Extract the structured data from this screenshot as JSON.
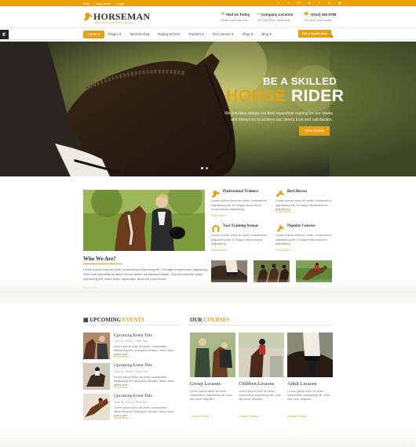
{
  "topbar": {
    "links": [
      "FAQ",
      "Help Desk",
      "Login"
    ],
    "social_icons": [
      "facebook-icon",
      "twitter-icon",
      "google-plus-icon",
      "instagram-icon",
      "pinterest-icon",
      "linkedin-icon",
      "rss-icon"
    ],
    "social_glyphs": [
      "f",
      "t",
      "G+",
      "◎",
      "P",
      "in",
      "◉"
    ]
  },
  "brand": {
    "name": "HORSEMAN",
    "tagline": "BEST EQUESTRIAN CENTER"
  },
  "header_info": {
    "mail": {
      "label": "Mail Us Today",
      "value": "info@yourdomain.com"
    },
    "location": {
      "label": "Company Location",
      "value": "121 King Street, Melbourne"
    },
    "phone": {
      "label": "+(012) 345 6789",
      "value": "Call us for more details"
    }
  },
  "nav": {
    "items": [
      "Home",
      "Pages",
      "Membership",
      "Riding School",
      "Trainers",
      "Our Horses",
      "Shop",
      "Blog"
    ],
    "dropdown": [
      true,
      true,
      false,
      false,
      true,
      true,
      true,
      true
    ],
    "cta": "Get A Quote Now"
  },
  "hero": {
    "line1": "BE A SKILLED",
    "line2_highlight": "HORSE",
    "line2_rest": "RIDER",
    "text": "We provides always our best equestrian training for our clients and always try to achieve our client's trust and satisfaction.",
    "button": "View Details",
    "slide_count": 2,
    "active_slide": 1
  },
  "features": [
    {
      "title": "Professional Trainers",
      "text": "Lorem ipsum dolor sit amet, consectetur adipisicing elit. El magni temporibus tempoesture adipisicing.",
      "link": "Read More →"
    },
    {
      "title": "Best Horses",
      "text": "Lorem ipsum dolor sit amet, consectetur adipisicing elit. El magni tempoesture adipisicing.",
      "link": "Read More →"
    },
    {
      "title": "Vast Training Arenas",
      "text": "Lorem ipsum dolor sit amet, consectetur adipisicing elit. El magni tempoesture adipisicing.",
      "link": "Read More →"
    },
    {
      "title": "Popular Courses",
      "text": "Lorem ipsum dolor sit amet, consectetur adipisicing elit. El magni tempoesture adipisicing.",
      "link": "Read More →"
    }
  ],
  "about": {
    "title": "Who We Are?",
    "text": "Lorem ipsum dolor sit amet, consectetur adipisicing elit. Et magni tempoesture adipisicing. Sunt iusto blanditiisunt aliunt omnisi dolore repellendus itaque. Quo recusandae quasi adipisicing elit, ullam sequi aspernatur deserunt perferendis.",
    "link": "Read More →"
  },
  "events": {
    "title_plain": "UPCOMING",
    "title_highlight": "EVENTS",
    "items": [
      {
        "title": "Upcoming Event Title",
        "meta": "June 26, 2016 | ⌂ New York",
        "text": "Lorem ipsum dolor sit amet, consectetur adipisicing elit. Ipsa quod veniam, nemo dicta, oliam num.",
        "link": "Read More →"
      },
      {
        "title": "Upcoming Event Title",
        "meta": "June 26, 2016 | ⌂ New York",
        "text": "Lorem ipsum dolor sit amet, consectetur adipisicing elit. Ipsa quod veniam, nemo dicta, oliam num.",
        "link": "Read More →"
      },
      {
        "title": "Upcoming Event Title",
        "meta": "June 26, 2016 | ⌂ New York",
        "text": "Lorem ipsum dolor sit amet, consectetur adipisicing elit. Ipsa quod veniam, nemo dicta, oliam num.",
        "link": "Read More →"
      }
    ]
  },
  "courses": {
    "title_plain": "OUR",
    "title_highlight": "COURSES",
    "items": [
      {
        "title": "Group Lessons",
        "text": "Lorem ipsum dolor sit amet, consectetur adipisicing elit. Ipsa sed illum. Aliquam.",
        "link": "Course Details →"
      },
      {
        "title": "Children Lessons",
        "text": "Lorem ipsum dolor sit amet, consectetur adipisicing elit. Ipsa sed illum. Aliquam.",
        "link": "Course Details →"
      },
      {
        "title": "Adult Lessons",
        "text": "Lorem ipsum dolor sit amet, consectetur adipisicing elit. Ipsa sed illum. Aliquam.",
        "link": "Course Details →"
      }
    ]
  },
  "colors": {
    "accent": "#e8a112",
    "dark_text": "#333333"
  }
}
